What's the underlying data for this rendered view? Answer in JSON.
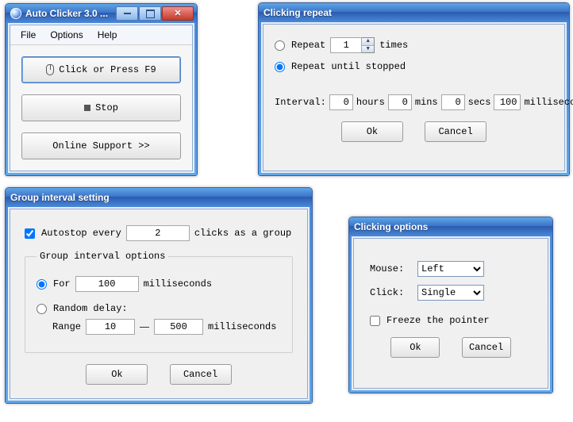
{
  "main": {
    "title": "Auto Clicker 3.0 ...",
    "menu": {
      "file": "File",
      "options": "Options",
      "help": "Help"
    },
    "buttons": {
      "click": "Click or Press F9",
      "stop": "Stop",
      "support": "Online Support >>"
    }
  },
  "repeat": {
    "title": "Clicking repeat",
    "opt_times_label": "Repeat",
    "opt_times_value": "1",
    "times_suffix": "times",
    "opt_until": "Repeat until stopped",
    "interval_label": "Interval:",
    "hours": "0",
    "hours_u": "hours",
    "mins": "0",
    "mins_u": "mins",
    "secs": "0",
    "secs_u": "secs",
    "ms": "100",
    "ms_u": "milliseconds",
    "ok": "Ok",
    "cancel": "Cancel"
  },
  "group": {
    "title": "Group interval setting",
    "autostop_label": "Autostop every",
    "autostop_value": "2",
    "autostop_suffix": "clicks as a group",
    "fs_legend": "Group interval options",
    "for_label": "For",
    "for_value": "100",
    "for_unit": "milliseconds",
    "random_label": "Random delay:",
    "range_label": "Range",
    "range_min": "10",
    "range_max": "500",
    "range_unit": "milliseconds",
    "ok": "Ok",
    "cancel": "Cancel"
  },
  "options": {
    "title": "Clicking options",
    "mouse_label": "Mouse:",
    "mouse_value": "Left",
    "click_label": "Click:",
    "click_value": "Single",
    "freeze_label": "Freeze the pointer",
    "ok": "Ok",
    "cancel": "Cancel"
  }
}
